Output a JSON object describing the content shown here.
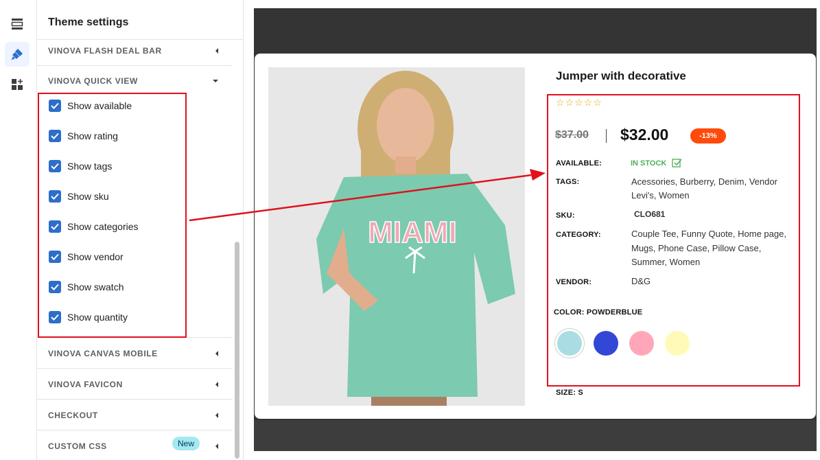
{
  "panel": {
    "title": "Theme settings",
    "sections": {
      "flash_deal": "VINOVA FLASH DEAL BAR",
      "quick_view": "VINOVA QUICK VIEW",
      "canvas_mobile": "VINOVA CANVAS MOBILE",
      "favicon": "VINOVA FAVICON",
      "checkout": "CHECKOUT",
      "custom_css": "CUSTOM CSS"
    },
    "custom_css_badge": "New",
    "options": [
      {
        "label": "Show available",
        "checked": true
      },
      {
        "label": "Show rating",
        "checked": true
      },
      {
        "label": "Show tags",
        "checked": true
      },
      {
        "label": "Show sku",
        "checked": true
      },
      {
        "label": "Show categories",
        "checked": true
      },
      {
        "label": "Show vendor",
        "checked": true
      },
      {
        "label": "Show swatch",
        "checked": true
      },
      {
        "label": "Show quantity",
        "checked": true
      }
    ]
  },
  "product": {
    "title": "Jumper with decorative",
    "rating_stars": "☆☆☆☆☆",
    "old_price": "$37.00",
    "price": "$32.00",
    "discount": "-13%",
    "shirt_text": "MIAMI",
    "available_label": "AVAILABLE:",
    "available_value": "IN STOCK",
    "tags_label": "TAGS:",
    "tags_line1": "Acessories, Burberry, Denim, Vendor",
    "tags_line2": "Levi's, Women",
    "sku_label": "SKU:",
    "sku_value": "CLO681",
    "category_label": "CATEGORY:",
    "category_line1": "Couple Tee, Funny Quote, Home page,",
    "category_line2": "Mugs, Phone Case, Pillow Case,",
    "category_line3": "Summer, Women",
    "vendor_label": "VENDOR:",
    "vendor_value": "D&G",
    "color_label": "COLOR: POWDERBLUE",
    "size_label": "SIZE: S",
    "swatches": [
      {
        "name": "powderblue",
        "color": "#a9dde3",
        "selected": true
      },
      {
        "name": "blue",
        "color": "#3247d6",
        "selected": false
      },
      {
        "name": "pink",
        "color": "#ffa7b8",
        "selected": false
      },
      {
        "name": "yellow",
        "color": "#fffab8",
        "selected": false
      }
    ]
  },
  "colors": {
    "accent": "#2c6ecb",
    "annotation": "#e0101d",
    "discount": "#ff4a0b",
    "in_stock": "#4fae57",
    "stars": "#e8a400"
  },
  "icons": {
    "rail": [
      "sections-icon",
      "theme-brush-icon",
      "app-blocks-icon"
    ]
  }
}
